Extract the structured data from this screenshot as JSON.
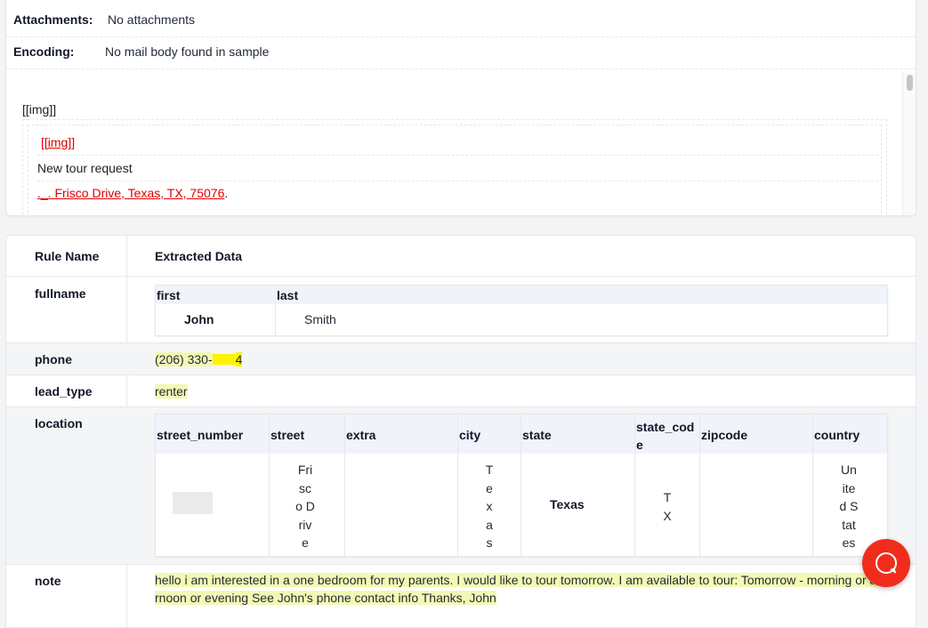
{
  "email": {
    "attachments_label": "Attachments:",
    "attachments_value": "No attachments",
    "encoding_label": "Encoding:",
    "encoding_value": "No mail body found in sample",
    "preview": {
      "img_placeholder": "[[img]]",
      "inner_img_link": "[[img]]",
      "heading": "New tour request",
      "address_prefix": "._. ",
      "address_link": "Frisco Drive, Texas, TX, 75076",
      "address_suffix": "."
    }
  },
  "table": {
    "headers": {
      "rule_name": "Rule Name",
      "extracted_data": "Extracted Data"
    },
    "fullname": {
      "rule": "fullname",
      "columns": [
        "first",
        "last"
      ],
      "values": [
        "John",
        "Smith"
      ]
    },
    "phone": {
      "rule": "phone",
      "value_visible": "(206) 330-",
      "value_tail": "4"
    },
    "lead_type": {
      "rule": "lead_type",
      "value": "renter"
    },
    "location": {
      "rule": "location",
      "columns": [
        "street_number",
        "street",
        "extra",
        "city",
        "state",
        "state_code",
        "zipcode",
        "country"
      ],
      "state_code_header_lines": [
        "state_cod",
        "e"
      ],
      "street_lines": [
        "Fri",
        "sc",
        "o D",
        "riv",
        "e"
      ],
      "city_lines": [
        "T",
        "e",
        "x",
        "a",
        "s"
      ],
      "state": "Texas",
      "state_code_lines": [
        "T",
        "X"
      ],
      "country_lines": [
        "Un",
        "ite",
        "d S",
        "tat",
        "es"
      ]
    },
    "note": {
      "rule": "note",
      "line1": "hello i am interested in a one bedroom for my parents. I would like to tour tomorrow. I am available to tour: Tomorrow - morning or a",
      "line2": "rnoon or evening See John's phone contact info Thanks, John"
    }
  },
  "colors": {
    "accent_red": "#f02d1c",
    "link_red": "#e00000",
    "highlight": "#f3f9b3",
    "mark": "#fff200"
  }
}
